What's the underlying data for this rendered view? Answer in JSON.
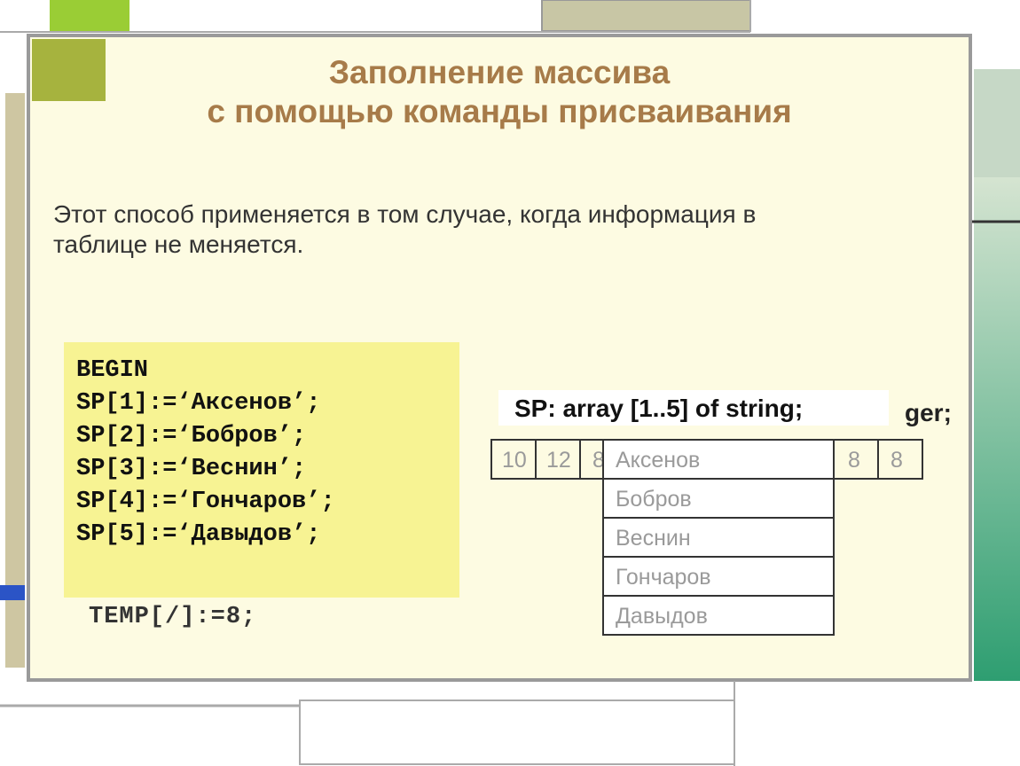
{
  "title_line1": "Заполнение массива",
  "title_line2": "с  помощью команды присваивания",
  "body_text": "Этот способ применяется в том случае, когда информация в таблице не меняется.",
  "code_begin": "BEGIN",
  "code_lines": [
    "SP[1]:=‘Аксенов’;",
    "SP[2]:=‘Бобров’;",
    "SP[3]:=‘Веснин’;",
    "SP[4]:=‘Гончаров’;",
    "SP[5]:=‘Давыдов’;"
  ],
  "code_partial": "TEMP[/]:=8;",
  "array_decl": "SP: array [1..5] of string;",
  "array_decl_peek": "er;",
  "array_decl_peek_full": "ger;",
  "sp_values": [
    "Аксенов",
    "Бобров",
    "Веснин",
    "Гончаров",
    "Давыдов"
  ],
  "temp_left": [
    "10",
    "12"
  ],
  "temp_mid": "8",
  "temp_right": [
    "8",
    "8"
  ]
}
